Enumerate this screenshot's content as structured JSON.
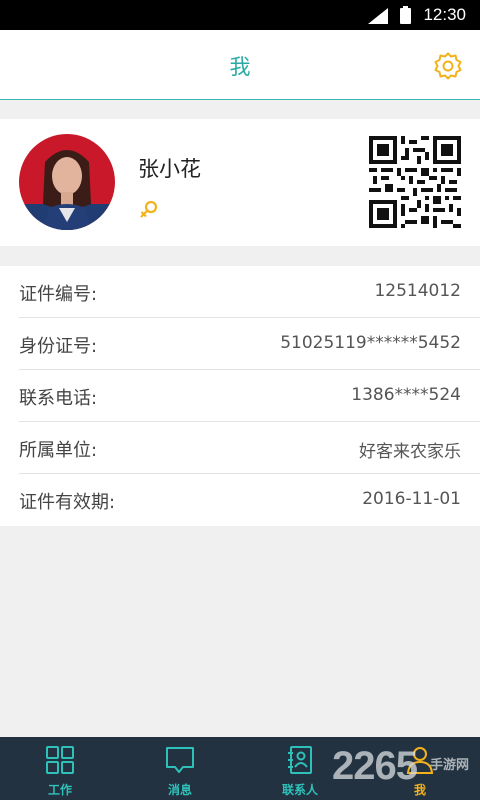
{
  "status_bar": {
    "time": "12:30",
    "signal_icon": "signal-icon",
    "battery_icon": "battery-icon"
  },
  "header": {
    "title": "我",
    "settings_icon": "gear-icon"
  },
  "profile": {
    "name": "张小花",
    "gender_icon": "female-icon",
    "qr_icon": "qr-code-icon",
    "avatar": "avatar-photo"
  },
  "info": {
    "rows": [
      {
        "label": "证件编号:",
        "value": "12514012"
      },
      {
        "label": "身份证号:",
        "value": "51025119******5452"
      },
      {
        "label": "联系电话:",
        "value": "1386****524"
      },
      {
        "label": "所属单位:",
        "value": "好客来农家乐"
      },
      {
        "label": "证件有效期:",
        "value": "2016-11-01"
      }
    ]
  },
  "tabs": [
    {
      "label": "工作",
      "icon": "grid-icon"
    },
    {
      "label": "消息",
      "icon": "message-icon"
    },
    {
      "label": "联系人",
      "icon": "contacts-icon"
    },
    {
      "label": "我",
      "icon": "person-icon",
      "active": true
    }
  ],
  "watermark": {
    "big": "2265",
    "small": "手游网"
  },
  "colors": {
    "accent": "#2aa9a3",
    "active_tab": "#f2b21c",
    "tabbar_bg": "#233240"
  }
}
